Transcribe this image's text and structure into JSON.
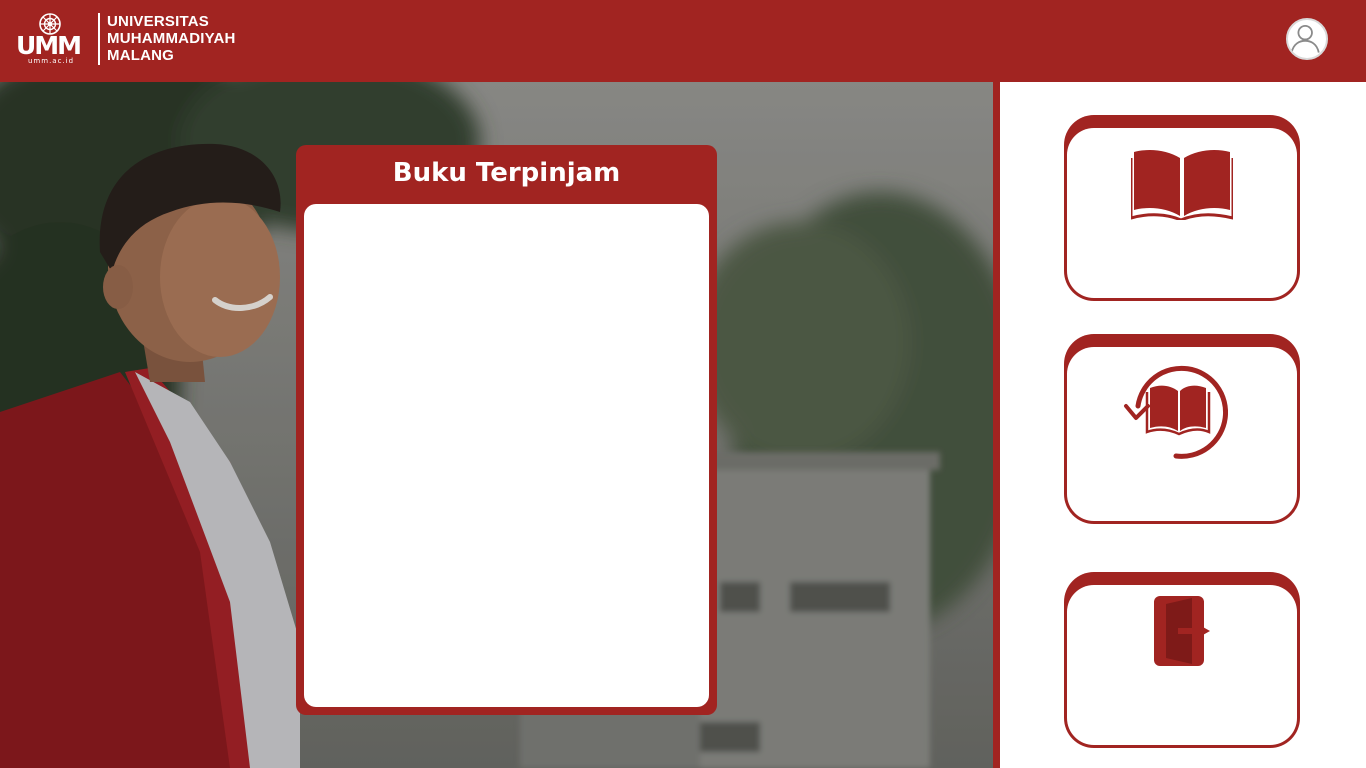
{
  "header": {
    "logo_abbrev": "UMM",
    "logo_url": "umm.ac.id",
    "logo_lines": [
      "UNIVERSITAS",
      "MUHAMMADIYAH",
      "MALANG"
    ],
    "profile_icon": "user-circle-icon"
  },
  "panel": {
    "title": "Buku Terpinjam",
    "items": []
  },
  "menu": [
    {
      "icon": "open-book-icon"
    },
    {
      "icon": "return-book-icon"
    },
    {
      "icon": "logout-door-icon"
    }
  ],
  "colors": {
    "brand": "#a12421",
    "panel_body": "#ffffff",
    "sidebar": "#ffffff"
  }
}
